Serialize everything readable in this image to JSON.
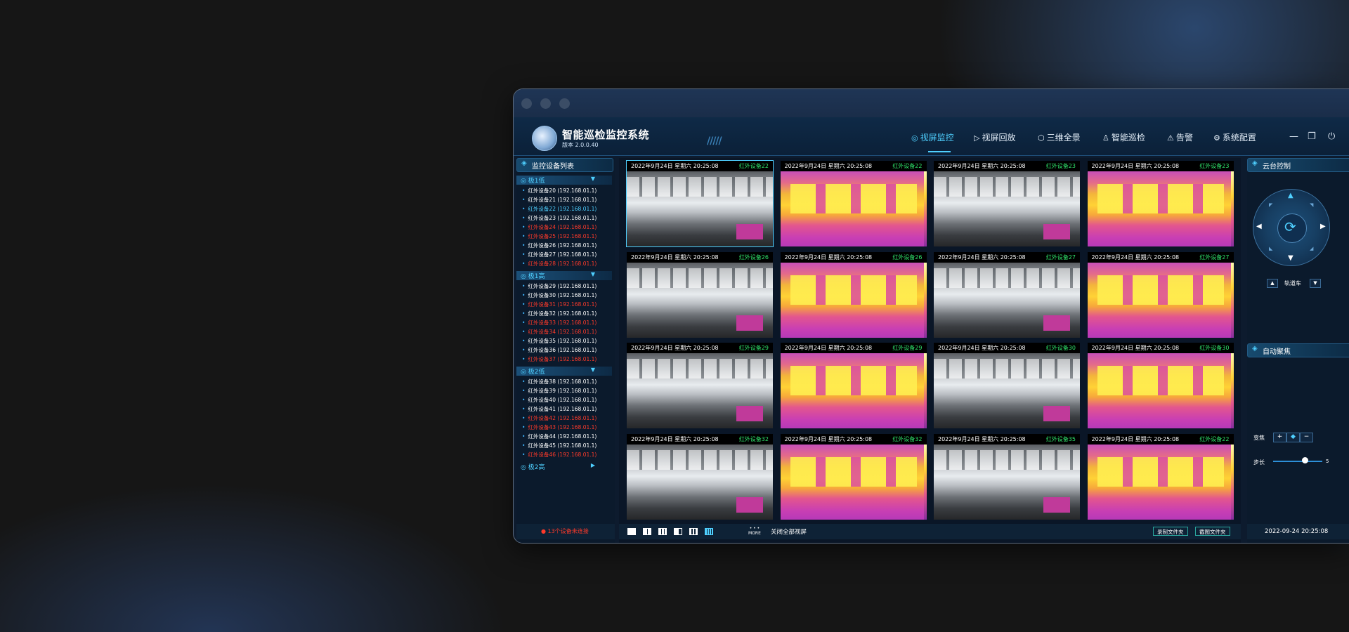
{
  "app": {
    "title": "智能巡检监控系统",
    "version": "版本 2.0.0.40"
  },
  "nav": [
    {
      "label": "视屏监控",
      "icon": "location-pin-icon",
      "active": true
    },
    {
      "label": "视屏回放",
      "icon": "play-icon",
      "active": false
    },
    {
      "label": "三维全景",
      "icon": "cube-icon",
      "active": false
    },
    {
      "label": "智能巡检",
      "icon": "user-icon",
      "active": false
    },
    {
      "label": "告警",
      "icon": "warning-icon",
      "active": false
    },
    {
      "label": "系统配置",
      "icon": "gear-icon",
      "active": false
    }
  ],
  "left_panel": {
    "title": "监控设备列表",
    "groups": [
      {
        "label": "极1低",
        "expanded": true,
        "devices": [
          {
            "name": "红外设备20 (192.168.01.1)",
            "status": "online"
          },
          {
            "name": "红外设备21 (192.168.01.1)",
            "status": "online"
          },
          {
            "name": "红外设备22 (192.168.01.1)",
            "status": "selected"
          },
          {
            "name": "红外设备23 (192.168.01.1)",
            "status": "online"
          },
          {
            "name": "红外设备24 (192.168.01.1)",
            "status": "offline"
          },
          {
            "name": "红外设备25 (192.168.01.1)",
            "status": "offline"
          },
          {
            "name": "红外设备26 (192.168.01.1)",
            "status": "online"
          },
          {
            "name": "红外设备27 (192.168.01.1)",
            "status": "online"
          },
          {
            "name": "红外设备28 (192.168.01.1)",
            "status": "offline"
          }
        ]
      },
      {
        "label": "极1高",
        "expanded": true,
        "devices": [
          {
            "name": "红外设备29 (192.168.01.1)",
            "status": "online"
          },
          {
            "name": "红外设备30 (192.168.01.1)",
            "status": "online"
          },
          {
            "name": "红外设备31 (192.168.01.1)",
            "status": "offline"
          },
          {
            "name": "红外设备32 (192.168.01.1)",
            "status": "online"
          },
          {
            "name": "红外设备33 (192.168.01.1)",
            "status": "offline"
          },
          {
            "name": "红外设备34 (192.168.01.1)",
            "status": "offline"
          },
          {
            "name": "红外设备35 (192.168.01.1)",
            "status": "online"
          },
          {
            "name": "红外设备36 (192.168.01.1)",
            "status": "online"
          },
          {
            "name": "红外设备37 (192.168.01.1)",
            "status": "offline"
          }
        ]
      },
      {
        "label": "极2低",
        "expanded": true,
        "devices": [
          {
            "name": "红外设备38 (192.168.01.1)",
            "status": "online"
          },
          {
            "name": "红外设备39 (192.168.01.1)",
            "status": "online"
          },
          {
            "name": "红外设备40 (192.168.01.1)",
            "status": "online"
          },
          {
            "name": "红外设备41 (192.168.01.1)",
            "status": "online"
          },
          {
            "name": "红外设备42 (192.168.01.1)",
            "status": "offline"
          },
          {
            "name": "红外设备43 (192.168.01.1)",
            "status": "offline"
          },
          {
            "name": "红外设备44 (192.168.01.1)",
            "status": "online"
          },
          {
            "name": "红外设备45 (192.168.01.1)",
            "status": "online"
          },
          {
            "name": "红外设备46 (192.168.01.1)",
            "status": "offline"
          }
        ]
      },
      {
        "label": "极2高",
        "expanded": false,
        "devices": []
      }
    ],
    "footer": "13个设备未连接"
  },
  "grid": {
    "timestamp": "2022年9月24日   星期六  20:25:08",
    "tiles": [
      {
        "name": "红外设备22",
        "kind": "visible",
        "selected": true
      },
      {
        "name": "红外设备22",
        "kind": "thermal"
      },
      {
        "name": "红外设备23",
        "kind": "visible"
      },
      {
        "name": "红外设备23",
        "kind": "thermal"
      },
      {
        "name": "红外设备26",
        "kind": "visible"
      },
      {
        "name": "红外设备26",
        "kind": "thermal"
      },
      {
        "name": "红外设备27",
        "kind": "visible"
      },
      {
        "name": "红外设备27",
        "kind": "thermal"
      },
      {
        "name": "红外设备29",
        "kind": "visible"
      },
      {
        "name": "红外设备29",
        "kind": "thermal"
      },
      {
        "name": "红外设备30",
        "kind": "visible"
      },
      {
        "name": "红外设备30",
        "kind": "thermal"
      },
      {
        "name": "红外设备32",
        "kind": "visible"
      },
      {
        "name": "红外设备32",
        "kind": "thermal"
      },
      {
        "name": "红外设备35",
        "kind": "visible"
      },
      {
        "name": "红外设备22",
        "kind": "thermal"
      }
    ]
  },
  "bottom_bar": {
    "more": "MORE",
    "close_all": "关闭全部视屏",
    "record_folder": "录制文件夹",
    "screenshot_folder": "截图文件夹"
  },
  "right_panel": {
    "ptz_title": "云台控制",
    "track_label": "轨道车",
    "focus_title": "自动聚焦",
    "zoom_label": "变焦",
    "step_label": "步长",
    "step_value": "5",
    "datetime": "2022-09-24   20:25:08"
  },
  "colors": {
    "accent": "#4fd0ff",
    "online_name": "#2fe26a",
    "offline": "#ff3a2a"
  }
}
